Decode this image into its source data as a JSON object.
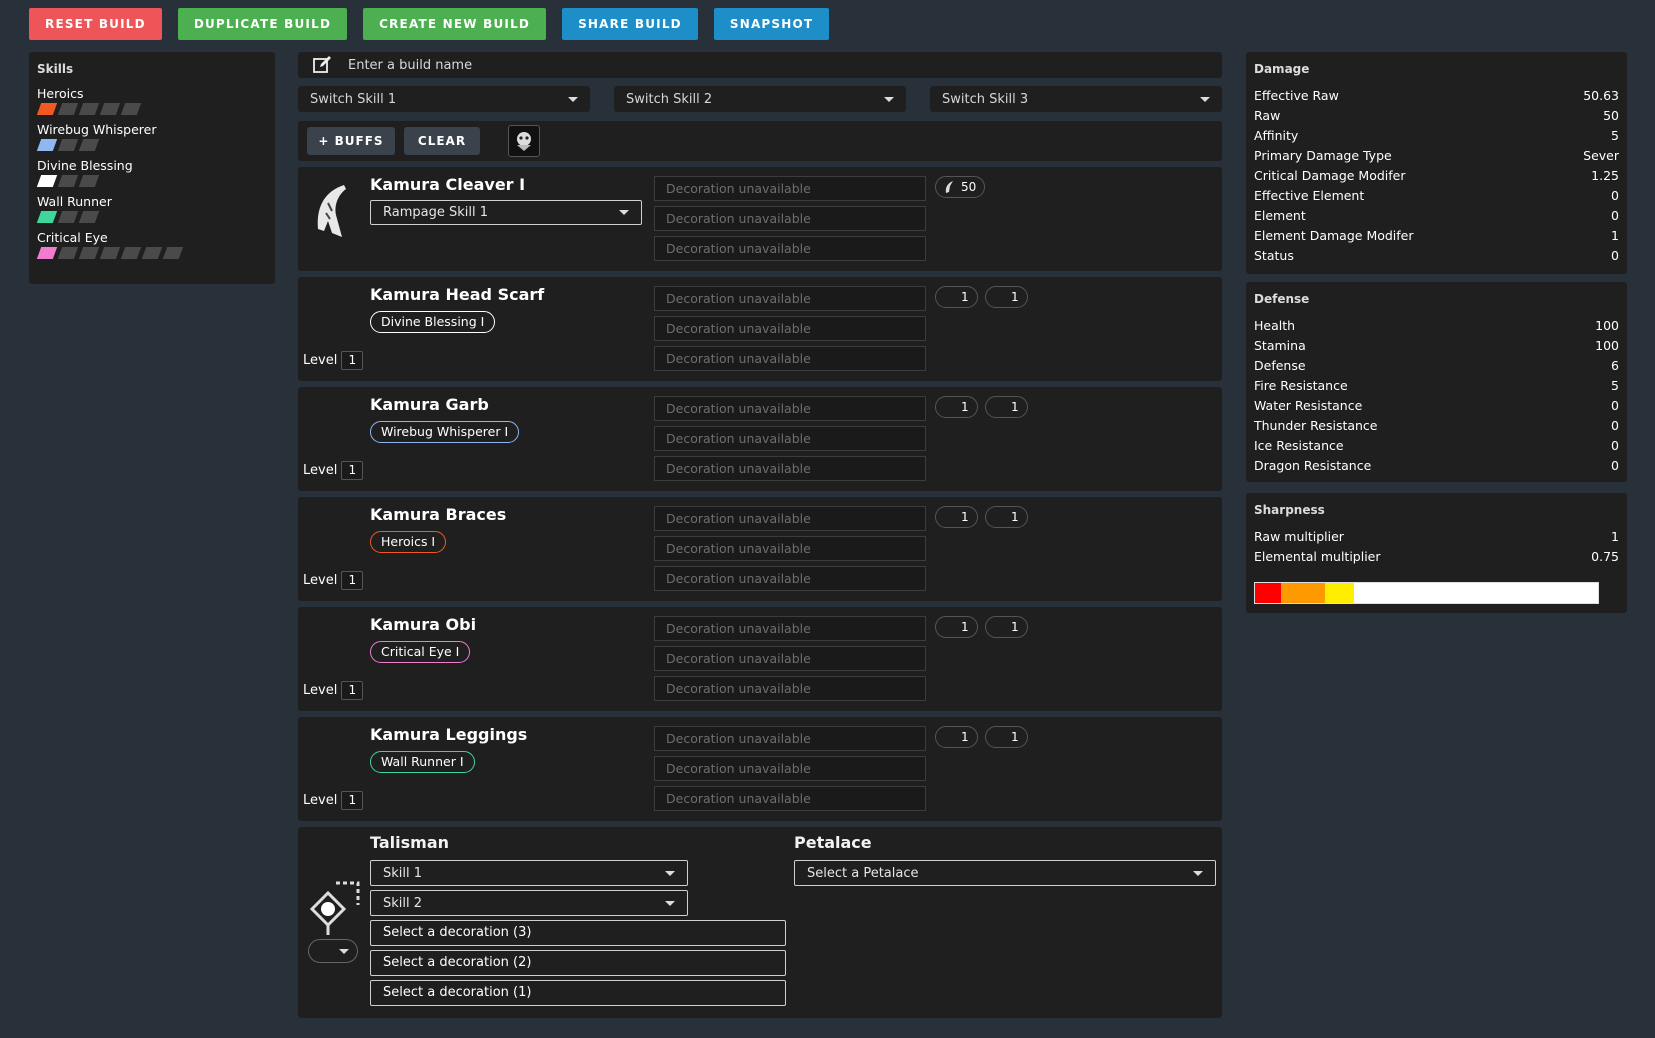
{
  "toolbar": {
    "reset": "RESET BUILD",
    "duplicate": "DUPLICATE BUILD",
    "create": "CREATE NEW BUILD",
    "share": "SHARE BUILD",
    "snapshot": "SNAPSHOT"
  },
  "skills": {
    "title": "Skills",
    "items": [
      {
        "name": "Heroics",
        "level": 1,
        "max": 5,
        "color": "#f05a22"
      },
      {
        "name": "Wirebug Whisperer",
        "level": 1,
        "max": 3,
        "color": "#8fb8f0"
      },
      {
        "name": "Divine Blessing",
        "level": 1,
        "max": 3,
        "color": "#ffffff"
      },
      {
        "name": "Wall Runner",
        "level": 1,
        "max": 3,
        "color": "#3ed69a"
      },
      {
        "name": "Critical Eye",
        "level": 1,
        "max": 7,
        "color": "#f07bcf"
      }
    ]
  },
  "build": {
    "name_placeholder": "Enter a build name",
    "switch_skills": [
      "Switch Skill 1",
      "Switch Skill 2",
      "Switch Skill 3"
    ],
    "buffs_label": "+ BUFFS",
    "clear_label": "CLEAR"
  },
  "weapon": {
    "name": "Kamura Cleaver I",
    "rampage": "Rampage Skill 1",
    "attack": "50",
    "decorations": [
      "Decoration unavailable",
      "Decoration unavailable",
      "Decoration unavailable"
    ]
  },
  "armor": [
    {
      "name": "Kamura Head Scarf",
      "skill": "Divine Blessing I",
      "skill_color": "#ffffff",
      "level_label": "Level",
      "level": "1",
      "defense": "1",
      "fire": "1",
      "decorations": [
        "Decoration unavailable",
        "Decoration unavailable",
        "Decoration unavailable"
      ]
    },
    {
      "name": "Kamura Garb",
      "skill": "Wirebug Whisperer I",
      "skill_color": "#8fb8f0",
      "level_label": "Level",
      "level": "1",
      "defense": "1",
      "fire": "1",
      "decorations": [
        "Decoration unavailable",
        "Decoration unavailable",
        "Decoration unavailable"
      ]
    },
    {
      "name": "Kamura Braces",
      "skill": "Heroics I",
      "skill_color": "#f05a22",
      "level_label": "Level",
      "level": "1",
      "defense": "1",
      "fire": "1",
      "decorations": [
        "Decoration unavailable",
        "Decoration unavailable",
        "Decoration unavailable"
      ]
    },
    {
      "name": "Kamura Obi",
      "skill": "Critical Eye I",
      "skill_color": "#f07bcf",
      "level_label": "Level",
      "level": "1",
      "defense": "1",
      "fire": "1",
      "decorations": [
        "Decoration unavailable",
        "Decoration unavailable",
        "Decoration unavailable"
      ]
    },
    {
      "name": "Kamura Leggings",
      "skill": "Wall Runner I",
      "skill_color": "#3ed69a",
      "level_label": "Level",
      "level": "1",
      "defense": "1",
      "fire": "1",
      "decorations": [
        "Decoration unavailable",
        "Decoration unavailable",
        "Decoration unavailable"
      ]
    }
  ],
  "talisman": {
    "title": "Talisman",
    "skill1": "Skill 1",
    "skill2": "Skill 2",
    "decorations": [
      "Select a decoration (3)",
      "Select a decoration (2)",
      "Select a decoration (1)"
    ]
  },
  "petalace": {
    "title": "Petalace",
    "placeholder": "Select a Petalace"
  },
  "damage": {
    "title": "Damage",
    "rows": [
      {
        "label": "Effective Raw",
        "value": "50.63"
      },
      {
        "label": "Raw",
        "value": "50"
      },
      {
        "label": "Affinity",
        "value": "5"
      },
      {
        "label": "Primary Damage Type",
        "value": "Sever"
      },
      {
        "label": "Critical Damage Modifer",
        "value": "1.25"
      },
      {
        "label": "Effective Element",
        "value": "0"
      },
      {
        "label": "Element",
        "value": "0"
      },
      {
        "label": "Element Damage Modifer",
        "value": "1"
      },
      {
        "label": "Status",
        "value": "0"
      }
    ]
  },
  "defense": {
    "title": "Defense",
    "rows": [
      {
        "label": "Health",
        "value": "100"
      },
      {
        "label": "Stamina",
        "value": "100"
      },
      {
        "label": "Defense",
        "value": "6"
      },
      {
        "label": "Fire Resistance",
        "value": "5"
      },
      {
        "label": "Water Resistance",
        "value": "0"
      },
      {
        "label": "Thunder Resistance",
        "value": "0"
      },
      {
        "label": "Ice Resistance",
        "value": "0"
      },
      {
        "label": "Dragon Resistance",
        "value": "0"
      }
    ]
  },
  "sharpness": {
    "title": "Sharpness",
    "rows": [
      {
        "label": "Raw multiplier",
        "value": "1"
      },
      {
        "label": "Elemental multiplier",
        "value": "0.75"
      }
    ],
    "segments": [
      {
        "color": "#ff0000",
        "fraction": 0.075
      },
      {
        "color": "#ff9900",
        "fraction": 0.13
      },
      {
        "color": "#ffee00",
        "fraction": 0.085
      }
    ]
  }
}
